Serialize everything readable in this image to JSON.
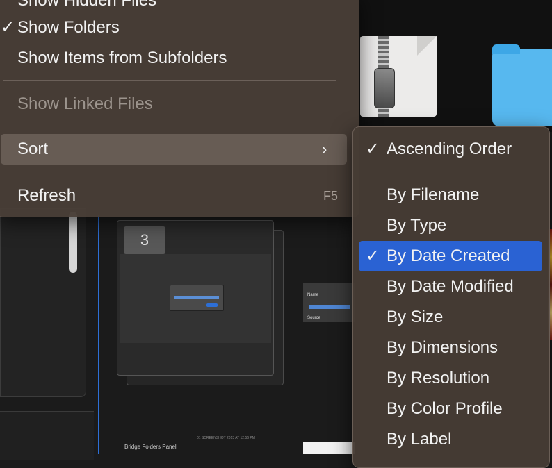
{
  "menu": {
    "items": [
      {
        "label": "Show Hidden Files",
        "checked": false
      },
      {
        "label": "Show Folders",
        "checked": true
      },
      {
        "label": "Show Items from Subfolders",
        "checked": false
      },
      {
        "label": "Show Linked Files",
        "checked": false,
        "disabled": true
      },
      {
        "label": "Sort",
        "submenu": true,
        "highlighted": true
      },
      {
        "label": "Refresh",
        "shortcut": "F5"
      }
    ]
  },
  "check_glyph": "✓",
  "chevron_glyph": "›",
  "sort_submenu": {
    "items": [
      {
        "label": "Ascending Order",
        "checked": true
      },
      {
        "label": "By Filename"
      },
      {
        "label": "By Type"
      },
      {
        "label": "By Date Created",
        "checked": true,
        "selected": true
      },
      {
        "label": "By Date Modified"
      },
      {
        "label": "By Size"
      },
      {
        "label": "By Dimensions"
      },
      {
        "label": "By Resolution"
      },
      {
        "label": "By Color Profile"
      },
      {
        "label": "By Label"
      }
    ]
  },
  "content": {
    "stack_count": "3",
    "thumbnail_caption": "Bridge Folders Panel",
    "thumbnail_timestamp": "01 SCREENSHOT 2013 AT 12:56 PM",
    "small_thumb_name": "Name",
    "small_thumb_source": "Source"
  },
  "colors": {
    "menu_bg": "#483e37",
    "selected_bg": "#2a62d3",
    "text": "#f2f2f2",
    "disabled_text": "#9c948d"
  }
}
